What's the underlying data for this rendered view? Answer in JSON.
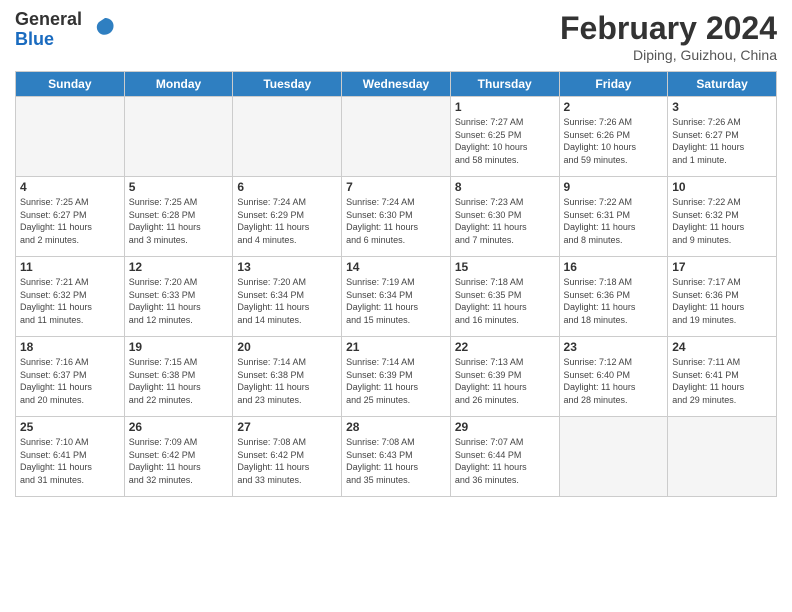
{
  "header": {
    "logo_general": "General",
    "logo_blue": "Blue",
    "month_year": "February 2024",
    "location": "Diping, Guizhou, China"
  },
  "days_of_week": [
    "Sunday",
    "Monday",
    "Tuesday",
    "Wednesday",
    "Thursday",
    "Friday",
    "Saturday"
  ],
  "weeks": [
    [
      {
        "day": "",
        "info": ""
      },
      {
        "day": "",
        "info": ""
      },
      {
        "day": "",
        "info": ""
      },
      {
        "day": "",
        "info": ""
      },
      {
        "day": "1",
        "info": "Sunrise: 7:27 AM\nSunset: 6:25 PM\nDaylight: 10 hours\nand 58 minutes."
      },
      {
        "day": "2",
        "info": "Sunrise: 7:26 AM\nSunset: 6:26 PM\nDaylight: 10 hours\nand 59 minutes."
      },
      {
        "day": "3",
        "info": "Sunrise: 7:26 AM\nSunset: 6:27 PM\nDaylight: 11 hours\nand 1 minute."
      }
    ],
    [
      {
        "day": "4",
        "info": "Sunrise: 7:25 AM\nSunset: 6:27 PM\nDaylight: 11 hours\nand 2 minutes."
      },
      {
        "day": "5",
        "info": "Sunrise: 7:25 AM\nSunset: 6:28 PM\nDaylight: 11 hours\nand 3 minutes."
      },
      {
        "day": "6",
        "info": "Sunrise: 7:24 AM\nSunset: 6:29 PM\nDaylight: 11 hours\nand 4 minutes."
      },
      {
        "day": "7",
        "info": "Sunrise: 7:24 AM\nSunset: 6:30 PM\nDaylight: 11 hours\nand 6 minutes."
      },
      {
        "day": "8",
        "info": "Sunrise: 7:23 AM\nSunset: 6:30 PM\nDaylight: 11 hours\nand 7 minutes."
      },
      {
        "day": "9",
        "info": "Sunrise: 7:22 AM\nSunset: 6:31 PM\nDaylight: 11 hours\nand 8 minutes."
      },
      {
        "day": "10",
        "info": "Sunrise: 7:22 AM\nSunset: 6:32 PM\nDaylight: 11 hours\nand 9 minutes."
      }
    ],
    [
      {
        "day": "11",
        "info": "Sunrise: 7:21 AM\nSunset: 6:32 PM\nDaylight: 11 hours\nand 11 minutes."
      },
      {
        "day": "12",
        "info": "Sunrise: 7:20 AM\nSunset: 6:33 PM\nDaylight: 11 hours\nand 12 minutes."
      },
      {
        "day": "13",
        "info": "Sunrise: 7:20 AM\nSunset: 6:34 PM\nDaylight: 11 hours\nand 14 minutes."
      },
      {
        "day": "14",
        "info": "Sunrise: 7:19 AM\nSunset: 6:34 PM\nDaylight: 11 hours\nand 15 minutes."
      },
      {
        "day": "15",
        "info": "Sunrise: 7:18 AM\nSunset: 6:35 PM\nDaylight: 11 hours\nand 16 minutes."
      },
      {
        "day": "16",
        "info": "Sunrise: 7:18 AM\nSunset: 6:36 PM\nDaylight: 11 hours\nand 18 minutes."
      },
      {
        "day": "17",
        "info": "Sunrise: 7:17 AM\nSunset: 6:36 PM\nDaylight: 11 hours\nand 19 minutes."
      }
    ],
    [
      {
        "day": "18",
        "info": "Sunrise: 7:16 AM\nSunset: 6:37 PM\nDaylight: 11 hours\nand 20 minutes."
      },
      {
        "day": "19",
        "info": "Sunrise: 7:15 AM\nSunset: 6:38 PM\nDaylight: 11 hours\nand 22 minutes."
      },
      {
        "day": "20",
        "info": "Sunrise: 7:14 AM\nSunset: 6:38 PM\nDaylight: 11 hours\nand 23 minutes."
      },
      {
        "day": "21",
        "info": "Sunrise: 7:14 AM\nSunset: 6:39 PM\nDaylight: 11 hours\nand 25 minutes."
      },
      {
        "day": "22",
        "info": "Sunrise: 7:13 AM\nSunset: 6:39 PM\nDaylight: 11 hours\nand 26 minutes."
      },
      {
        "day": "23",
        "info": "Sunrise: 7:12 AM\nSunset: 6:40 PM\nDaylight: 11 hours\nand 28 minutes."
      },
      {
        "day": "24",
        "info": "Sunrise: 7:11 AM\nSunset: 6:41 PM\nDaylight: 11 hours\nand 29 minutes."
      }
    ],
    [
      {
        "day": "25",
        "info": "Sunrise: 7:10 AM\nSunset: 6:41 PM\nDaylight: 11 hours\nand 31 minutes."
      },
      {
        "day": "26",
        "info": "Sunrise: 7:09 AM\nSunset: 6:42 PM\nDaylight: 11 hours\nand 32 minutes."
      },
      {
        "day": "27",
        "info": "Sunrise: 7:08 AM\nSunset: 6:42 PM\nDaylight: 11 hours\nand 33 minutes."
      },
      {
        "day": "28",
        "info": "Sunrise: 7:08 AM\nSunset: 6:43 PM\nDaylight: 11 hours\nand 35 minutes."
      },
      {
        "day": "29",
        "info": "Sunrise: 7:07 AM\nSunset: 6:44 PM\nDaylight: 11 hours\nand 36 minutes."
      },
      {
        "day": "",
        "info": ""
      },
      {
        "day": "",
        "info": ""
      }
    ]
  ]
}
